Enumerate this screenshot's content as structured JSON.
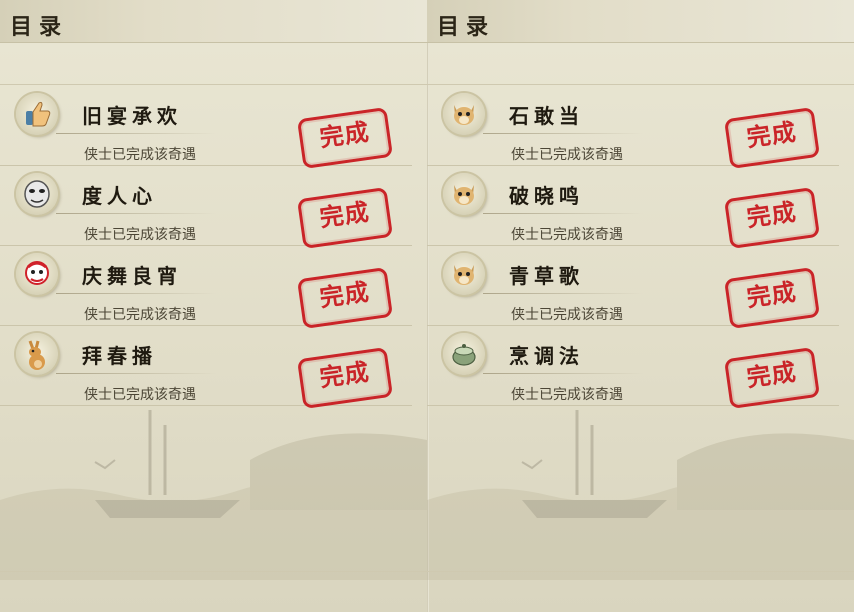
{
  "panels": [
    {
      "title": "目录",
      "entries": [
        {
          "name": "旧宴承欢",
          "status": "侠士已完成该奇遇",
          "stamp": "完成",
          "icon": "thumbs-up-icon"
        },
        {
          "name": "度人心",
          "status": "侠士已完成该奇遇",
          "stamp": "完成",
          "icon": "mask-icon"
        },
        {
          "name": "庆舞良宵",
          "status": "侠士已完成该奇遇",
          "stamp": "完成",
          "icon": "lion-dance-icon"
        },
        {
          "name": "拜春播",
          "status": "侠士已完成该奇遇",
          "stamp": "完成",
          "icon": "kangaroo-icon"
        }
      ]
    },
    {
      "title": "目录",
      "entries": [
        {
          "name": "石敢当",
          "status": "侠士已完成该奇遇",
          "stamp": "完成",
          "icon": "cat-icon"
        },
        {
          "name": "破晓鸣",
          "status": "侠士已完成该奇遇",
          "stamp": "完成",
          "icon": "cat-icon"
        },
        {
          "name": "青草歌",
          "status": "侠士已完成该奇遇",
          "stamp": "完成",
          "icon": "cat-icon"
        },
        {
          "name": "烹调法",
          "status": "侠士已完成该奇遇",
          "stamp": "完成",
          "icon": "pot-icon"
        }
      ]
    }
  ],
  "colors": {
    "stamp": "#c8151b",
    "background": "#e3e0cd"
  }
}
